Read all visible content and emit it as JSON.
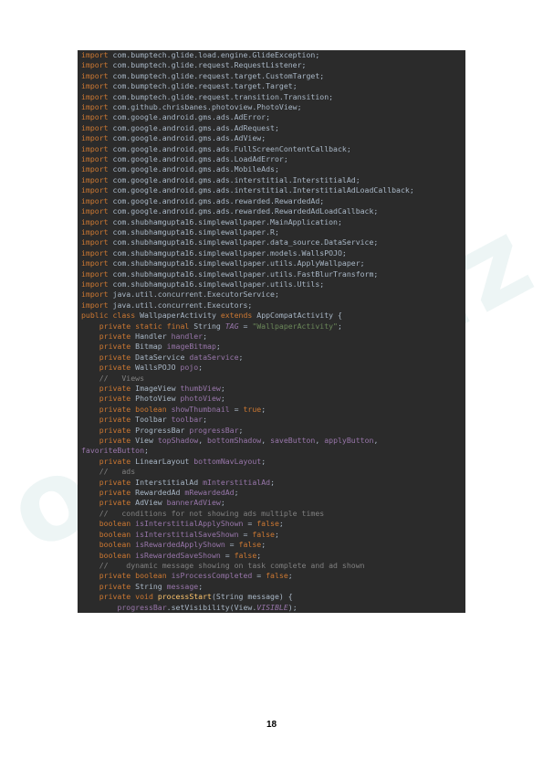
{
  "page_number": "18",
  "watermark": "oefen.uz",
  "code": {
    "imports": [
      "com.bumptech.glide.load.engine.GlideException",
      "com.bumptech.glide.request.RequestListener",
      "com.bumptech.glide.request.target.CustomTarget",
      "com.bumptech.glide.request.target.Target",
      "com.bumptech.glide.request.transition.Transition",
      "com.github.chrisbanes.photoview.PhotoView",
      "com.google.android.gms.ads.AdError",
      "com.google.android.gms.ads.AdRequest",
      "com.google.android.gms.ads.AdView",
      "com.google.android.gms.ads.FullScreenContentCallback",
      "com.google.android.gms.ads.LoadAdError",
      "com.google.android.gms.ads.MobileAds",
      "com.google.android.gms.ads.interstitial.InterstitialAd",
      "com.google.android.gms.ads.interstitial.InterstitialAdLoadCallback",
      "com.google.android.gms.ads.rewarded.RewardedAd",
      "com.google.android.gms.ads.rewarded.RewardedAdLoadCallback",
      "com.shubhamgupta16.simplewallpaper.MainApplication",
      "com.shubhamgupta16.simplewallpaper.R",
      "com.shubhamgupta16.simplewallpaper.data_source.DataService",
      "com.shubhamgupta16.simplewallpaper.models.WallsPOJO",
      "com.shubhamgupta16.simplewallpaper.utils.ApplyWallpaper",
      "com.shubhamgupta16.simplewallpaper.utils.FastBlurTransform",
      "com.shubhamgupta16.simplewallpaper.utils.Utils"
    ],
    "imports2": [
      "java.util.concurrent.ExecutorService",
      "java.util.concurrent.Executors"
    ],
    "class_decl": {
      "modifiers": "public class",
      "name": "WallpaperActivity",
      "extends_kw": "extends",
      "super": "AppCompatActivity"
    },
    "tag_line": {
      "mods": "private static final",
      "type": "String",
      "name": "TAG",
      "eq": "=",
      "value": "\"WallpaperActivity\""
    },
    "fields": [
      {
        "mods": "private",
        "type": "Handler",
        "name": "handler"
      },
      {
        "mods": "private",
        "type": "Bitmap",
        "name": "imageBitmap"
      },
      {
        "mods": "private",
        "type": "DataService",
        "name": "dataService"
      },
      {
        "mods": "private",
        "type": "WallsPOJO",
        "name": "pojo"
      }
    ],
    "views_comment": "//   Views",
    "view_fields": [
      {
        "mods": "private",
        "type": "ImageView",
        "name": "thumbView"
      },
      {
        "mods": "private",
        "type": "PhotoView",
        "name": "photoView"
      },
      {
        "mods": "private",
        "type": "boolean",
        "name": "showThumbnail",
        "init": "true"
      },
      {
        "mods": "private",
        "type": "Toolbar",
        "name": "toolbar"
      },
      {
        "mods": "private",
        "type": "ProgressBar",
        "name": "progressBar"
      },
      {
        "mods": "private",
        "type": "View",
        "names": "topShadow, bottomShadow, saveButton, applyButton, favoriteButton"
      },
      {
        "mods": "private",
        "type": "LinearLayout",
        "name": "bottomNavLayout"
      }
    ],
    "ads_comment": "//   ads",
    "ad_fields": [
      {
        "mods": "private",
        "type": "InterstitialAd",
        "name": "mInterstitialAd"
      },
      {
        "mods": "private",
        "type": "RewardedAd",
        "name": "mRewardedAd"
      },
      {
        "mods": "private",
        "type": "AdView",
        "name": "bannerAdView"
      }
    ],
    "cond_comment": "//   conditions for not showing ads multiple times",
    "cond_fields": [
      {
        "type": "boolean",
        "name": "isInterstitialApplyShown",
        "init": "false"
      },
      {
        "type": "boolean",
        "name": "isInterstitialSaveShown",
        "init": "false"
      },
      {
        "type": "boolean",
        "name": "isRewardedApplyShown",
        "init": "false"
      },
      {
        "type": "boolean",
        "name": "isRewardedSaveShown",
        "init": "false"
      }
    ],
    "dyn_comment": "//    dynamic message showing on task complete and ad shown",
    "dyn_fields": [
      {
        "mods": "private",
        "type": "boolean",
        "name": "isProcessCompleted",
        "init": "false"
      },
      {
        "mods": "private",
        "type": "String",
        "name": "message"
      }
    ],
    "method": {
      "mods": "private void",
      "name": "processStart",
      "params": "(String message) {",
      "body_prefix": "progressBar",
      "body_call": ".setVisibility(View.",
      "body_const": "VISIBLE",
      "body_end": ");"
    }
  }
}
